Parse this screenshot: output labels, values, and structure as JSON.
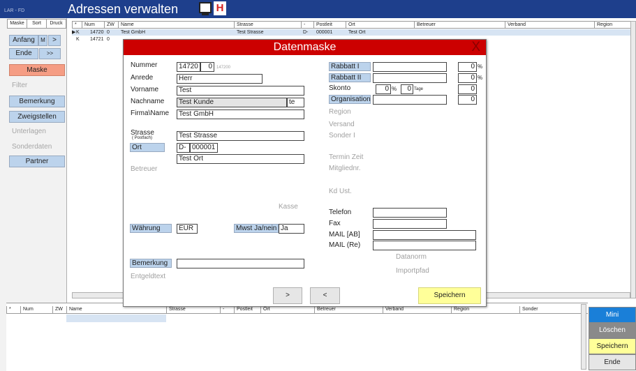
{
  "window": {
    "app_label": "LAR - FD",
    "title": "Adressen verwalten",
    "h_button": "H"
  },
  "sidebar": {
    "tabs": [
      "Maske",
      "Sort",
      "Druck"
    ],
    "anfang": "Anfang",
    "m": "M",
    "gt": ">",
    "ende": "Ende",
    "gtgt": ">>",
    "maske": "Maske",
    "filter": "Filter",
    "bemerkung": "Bemerkung",
    "zweigstellen": "Zweigstellen",
    "unterlagen": "Unterlagen",
    "sonderdaten": "Sonderdaten",
    "partner": "Partner"
  },
  "grid": {
    "columns": [
      "*",
      "Num",
      "ZW",
      "Name",
      "Strasse",
      "-",
      "Postleit",
      "Ort",
      "Betreuer",
      "Verband",
      "Region"
    ],
    "rows": [
      {
        "marker": "▶",
        "type": "K",
        "num": "14720",
        "zw": "0",
        "name": "Test GmbH",
        "strasse": "Test Strasse",
        "land": "D-",
        "plz": "000001",
        "ort": "Test Ort"
      },
      {
        "marker": "",
        "type": "K",
        "num": "14721",
        "zw": "0",
        "name": "",
        "strasse": "",
        "land": "",
        "plz": "",
        "ort": ""
      }
    ]
  },
  "modal": {
    "title": "Datenmaske",
    "close": "X",
    "nummer_label": "Nummer",
    "nummer": "14720",
    "nummer_zw": "0",
    "nummer_hint": "147200",
    "anrede_label": "Anrede",
    "anrede": "Herr",
    "vorname_label": "Vorname",
    "vorname": "Test",
    "nachname_label": "Nachname",
    "nachname": "Test Kunde",
    "nachname_suffix": "te",
    "firma_label": "Firma\\Name",
    "firma": "Test GmbH",
    "strasse_label": "Strasse",
    "strasse_sub": "( Postfach)",
    "strasse": "Test Strasse",
    "ort_label": "Ort",
    "land": "D-",
    "plz": "000001",
    "ort": "Test Ort",
    "betreuer_label": "Betreuer",
    "kasse_label": "Kasse",
    "waehrung_label": "Währung",
    "waehrung": "EUR",
    "mwst_label": "Mwst Ja/nein",
    "mwst": "Ja",
    "bemerkung_label": "Bemerkung",
    "bemerkung": "",
    "entgeldtext_label": "Entgeldtext",
    "rabatt1_label": "Rabbatt I",
    "rabatt1_val": "0",
    "rabatt1_unit": "%",
    "rabatt2_label": "Rabbatt II",
    "rabatt2_val": "0",
    "rabatt2_unit": "%",
    "skonto_label": "Skonto",
    "skonto_pct": "0",
    "skonto_pct_unit": "%",
    "skonto_tage": "0",
    "skonto_tage_unit": "Tage",
    "skonto_right": "0",
    "organisation_label": "Organisation",
    "organisation_right": "0",
    "region_label": "Region",
    "versand_label": "Versand",
    "sonder_label": "Sonder I",
    "termin_label": "Termin Zeit",
    "mitglied_label": "Mitgliednr.",
    "kdust_label": "Kd Ust.",
    "telefon_label": "Telefon",
    "fax_label": "Fax",
    "mail_ab_label": "MAIL [AB]",
    "mail_re_label": "MAIL (Re)",
    "datanorm_label": "Datanorm",
    "importpfad_label": "Importpfad",
    "next_button": ">",
    "prev_button": "<",
    "save_button": "Speichern"
  },
  "bottom_grid": {
    "columns": [
      "*",
      "Num",
      "ZW",
      "Name",
      "Strasse",
      "-",
      "Postleit",
      "Ort",
      "Betreuer",
      "Verband",
      "Region",
      "Sonder"
    ]
  },
  "right_buttons": {
    "mini": "Mini",
    "loeschen": "Löschen",
    "speichern": "Speichern",
    "ende": "Ende"
  },
  "colors": {
    "titlebar": "#1e3f8c",
    "modal_header": "#cc0000",
    "button_blue": "#bcd3ec",
    "button_red": "#f59d84",
    "save_yellow": "#ffff99",
    "mini_blue": "#1a7fd8"
  }
}
